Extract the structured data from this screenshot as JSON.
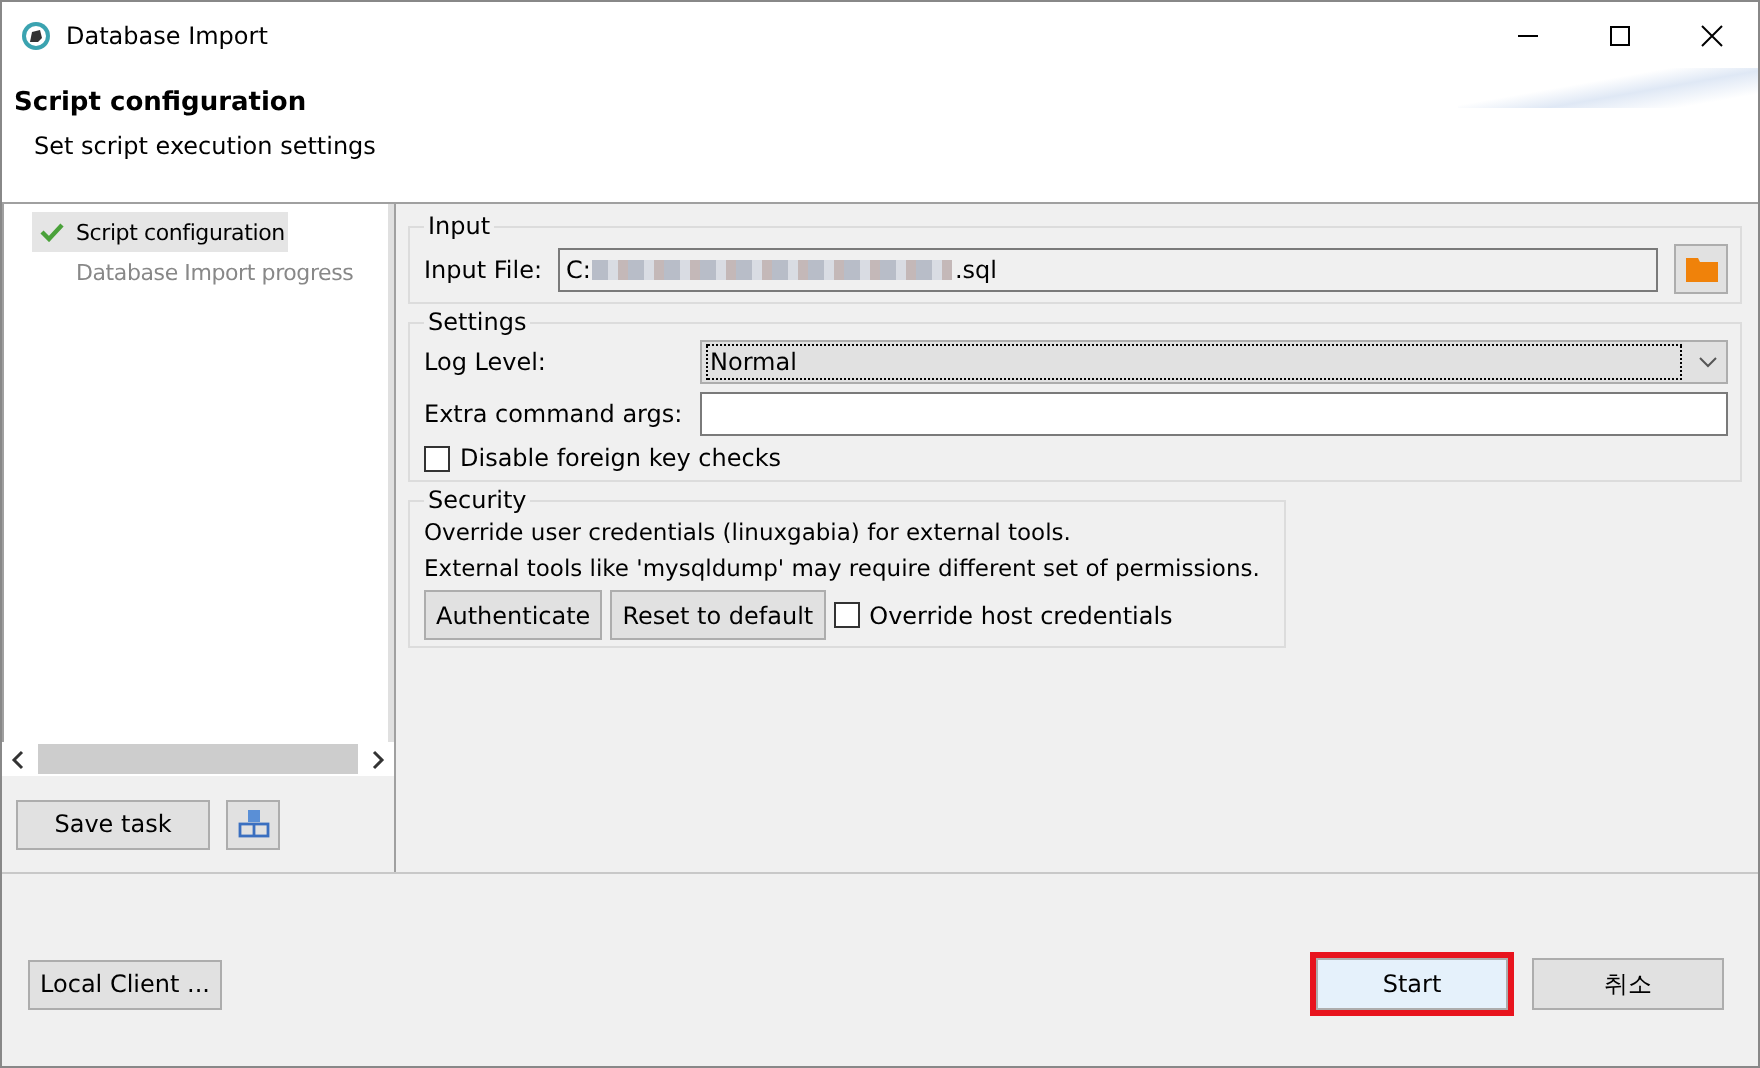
{
  "window": {
    "title": "Database Import"
  },
  "header": {
    "title": "Script configuration",
    "subtitle": "Set script execution settings"
  },
  "steps": [
    {
      "label": "Script configuration",
      "selected": true,
      "done": true
    },
    {
      "label": "Database Import progress",
      "selected": false,
      "done": false
    }
  ],
  "sidebar_buttons": {
    "save": "Save task"
  },
  "input_group": {
    "title": "Input",
    "file_label": "Input File:",
    "file_value_start": "C:",
    "file_value_end": ".sql"
  },
  "settings_group": {
    "title": "Settings",
    "log_level_label": "Log Level:",
    "log_level_value": "Normal",
    "extra_args_label": "Extra command args:",
    "disable_fk": {
      "label": "Disable foreign key checks",
      "checked": false
    }
  },
  "security_group": {
    "title": "Security",
    "line1": "Override user credentials (linuxgabia) for external tools.",
    "line2": "External tools like 'mysqldump' may require different set of permissions.",
    "buttons": [
      "Authenticate",
      "Reset to default"
    ],
    "override_host": {
      "label": "Override host credentials",
      "checked": false
    }
  },
  "footer": {
    "left_button": "Local Client ...",
    "start": {
      "label": "Start",
      "highlighted": true
    },
    "cancel": "취소"
  }
}
